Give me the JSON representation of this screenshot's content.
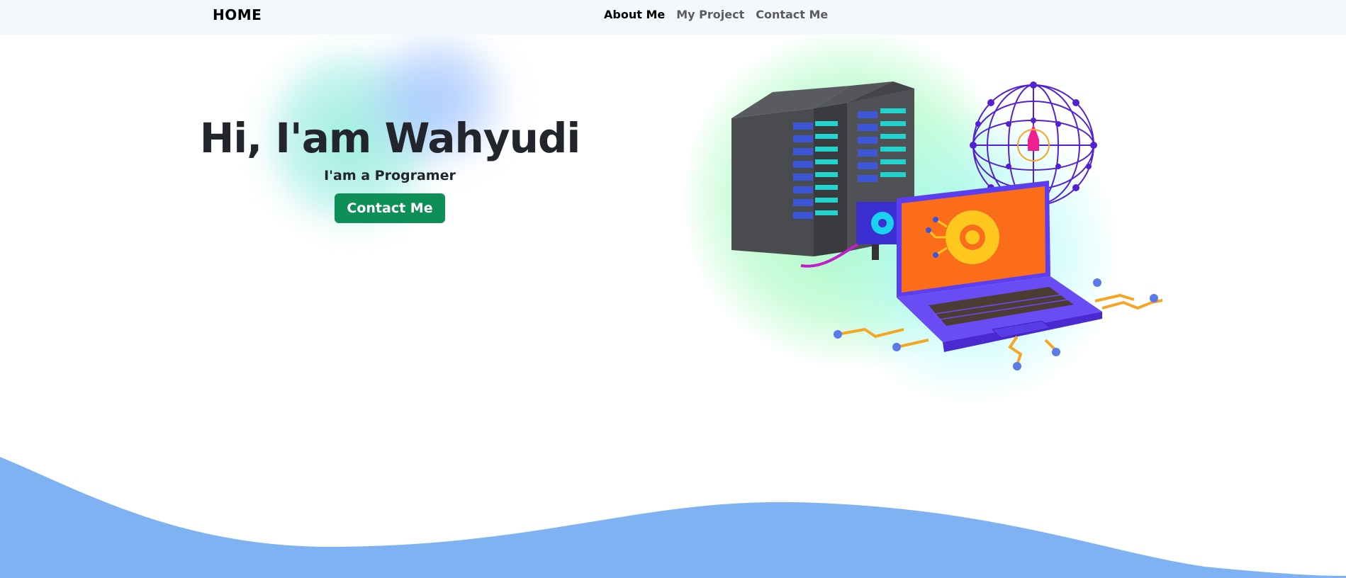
{
  "navbar": {
    "brand": "HOME",
    "links": [
      {
        "label": "About Me",
        "active": true
      },
      {
        "label": "My Project",
        "active": false
      },
      {
        "label": "Contact Me",
        "active": false
      }
    ]
  },
  "hero": {
    "title": "Hi, I'am Wahyudi",
    "subtitle": "I'am a Programer",
    "cta_label": "Contact Me",
    "illustration_icon": "server-laptop-network-illustration"
  },
  "colors": {
    "navbar_bg": "#f2f8fc",
    "cta_bg": "#0e8f58",
    "wave": "#7eb2f3",
    "text": "#23252c"
  }
}
